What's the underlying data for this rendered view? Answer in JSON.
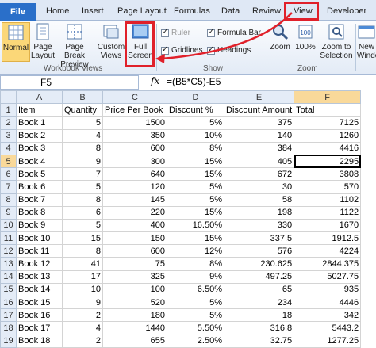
{
  "tabs": {
    "file": "File",
    "home": "Home",
    "insert": "Insert",
    "page_layout": "Page Layout",
    "formulas": "Formulas",
    "data": "Data",
    "review": "Review",
    "view": "View",
    "developer": "Developer"
  },
  "ribbon": {
    "normal": "Normal",
    "page_layout_1": "Page",
    "page_layout_2": "Layout",
    "page_break_1": "Page Break",
    "page_break_2": "Preview",
    "custom_1": "Custom",
    "custom_2": "Views",
    "full_1": "Full",
    "full_2": "Screen",
    "workbook_views": "Workbook Views",
    "ruler": "Ruler",
    "formula_bar": "Formula Bar",
    "gridlines": "Gridlines",
    "headings": "Headings",
    "show": "Show",
    "zoom": "Zoom",
    "zoom100": "100%",
    "zoom_sel_1": "Zoom to",
    "zoom_sel_2": "Selection",
    "new_win_1": "New",
    "new_win_2": "Windo"
  },
  "formula_bar": {
    "name_box": "F5",
    "fx": "fx",
    "formula": "=(B5*C5)-E5"
  },
  "columns": [
    "",
    "A",
    "B",
    "C",
    "D",
    "E",
    "F"
  ],
  "rows": [
    [
      "1",
      "Item",
      "Quantity",
      "Price Per Book",
      "Discount %",
      "Discount Amount",
      "Total"
    ],
    [
      "2",
      "Book 1",
      "5",
      "1500",
      "5%",
      "375",
      "7125"
    ],
    [
      "3",
      "Book 2",
      "4",
      "350",
      "10%",
      "140",
      "1260"
    ],
    [
      "4",
      "Book 3",
      "8",
      "600",
      "8%",
      "384",
      "4416"
    ],
    [
      "5",
      "Book 4",
      "9",
      "300",
      "15%",
      "405",
      "2295"
    ],
    [
      "6",
      "Book 5",
      "7",
      "640",
      "15%",
      "672",
      "3808"
    ],
    [
      "7",
      "Book 6",
      "5",
      "120",
      "5%",
      "30",
      "570"
    ],
    [
      "8",
      "Book 7",
      "8",
      "145",
      "5%",
      "58",
      "1102"
    ],
    [
      "9",
      "Book 8",
      "6",
      "220",
      "15%",
      "198",
      "1122"
    ],
    [
      "10",
      "Book 9",
      "5",
      "400",
      "16.50%",
      "330",
      "1670"
    ],
    [
      "11",
      "Book 10",
      "15",
      "150",
      "15%",
      "337.5",
      "1912.5"
    ],
    [
      "12",
      "Book 11",
      "8",
      "600",
      "12%",
      "576",
      "4224"
    ],
    [
      "13",
      "Book 12",
      "41",
      "75",
      "8%",
      "230.625",
      "2844.375"
    ],
    [
      "14",
      "Book 13",
      "17",
      "325",
      "9%",
      "497.25",
      "5027.75"
    ],
    [
      "15",
      "Book 14",
      "10",
      "100",
      "6.50%",
      "65",
      "935"
    ],
    [
      "16",
      "Book 15",
      "9",
      "520",
      "5%",
      "234",
      "4446"
    ],
    [
      "17",
      "Book 16",
      "2",
      "180",
      "5%",
      "18",
      "342"
    ],
    [
      "18",
      "Book 17",
      "4",
      "1440",
      "5.50%",
      "316.8",
      "5443.2"
    ],
    [
      "19",
      "Book 18",
      "2",
      "655",
      "2.50%",
      "32.75",
      "1277.25"
    ]
  ],
  "colors": {
    "highlight": "#e0202a",
    "file_tab": "#2a6fc9"
  }
}
